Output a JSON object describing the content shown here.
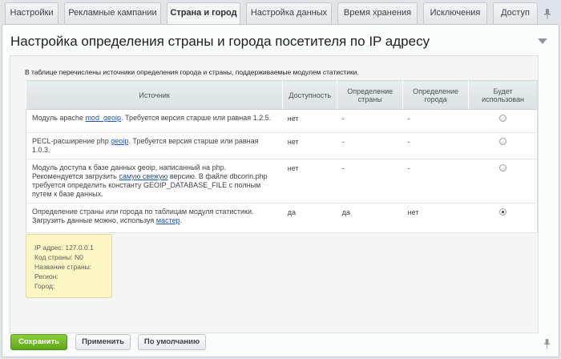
{
  "tabs": [
    {
      "label": "Настройки"
    },
    {
      "label": "Рекламные кампании"
    },
    {
      "label": "Страна и город",
      "active": true
    },
    {
      "label": "Настройка данных"
    },
    {
      "label": "Время хранения"
    },
    {
      "label": "Исключения"
    },
    {
      "label": "Доступ"
    }
  ],
  "page": {
    "title": "Настройка определения страны и города посетителя по IP адресу",
    "description": "В таблице перечислены источники определения города и страны, поддерживаемые модулем статистики."
  },
  "table": {
    "headers": {
      "source": "Источник",
      "availability": "Доступность",
      "country_line1": "Определение",
      "country_line2": "страны",
      "city_line1": "Определение",
      "city_line2": "города",
      "used_line1": "Будет",
      "used_line2": "использован"
    },
    "rows": [
      {
        "text_before": "Модуль apache ",
        "link": "mod_geoip",
        "text_after": ". Требуется версия старше или равная 1.2.5.",
        "availability": "нет",
        "country": "-",
        "city": "-",
        "selected": false
      },
      {
        "text_before": "PECL-расширение php ",
        "link": "geoip",
        "text_after": ". Требуется версия старше или равная 1.0.3.",
        "availability": "нет",
        "country": "-",
        "city": "-",
        "selected": false
      },
      {
        "text_before": "Модуль доступа к базе данных geoip, написанный на php. Рекомендуется загрузить ",
        "link": "самую свежую",
        "text_after": " версию. В файле dbconn.php требуется определить константу GEOIP_DATABASE_FILE с полным путем к базе данных.",
        "availability": "нет",
        "country": "-",
        "city": "-",
        "selected": false
      },
      {
        "text_before": "Определение страны или города по таблицам модуля статистики. Загрузить данные можно, используя ",
        "link": "мастер",
        "text_after": ".",
        "availability": "да",
        "country": "да",
        "city": "нет",
        "selected": true
      }
    ]
  },
  "info": {
    "ip": "IP адрес: 127.0.0.1",
    "country_code": "Код страны: N0",
    "country_name": "Название страны:",
    "region": "Регион:",
    "city": "Город:"
  },
  "buttons": {
    "save": "Сохранить",
    "apply": "Применить",
    "default": "По умолчанию"
  },
  "colors": {
    "accent_green": "#6ab423",
    "link_blue": "#1f55a5",
    "info_yellow": "#fcf5c4"
  }
}
